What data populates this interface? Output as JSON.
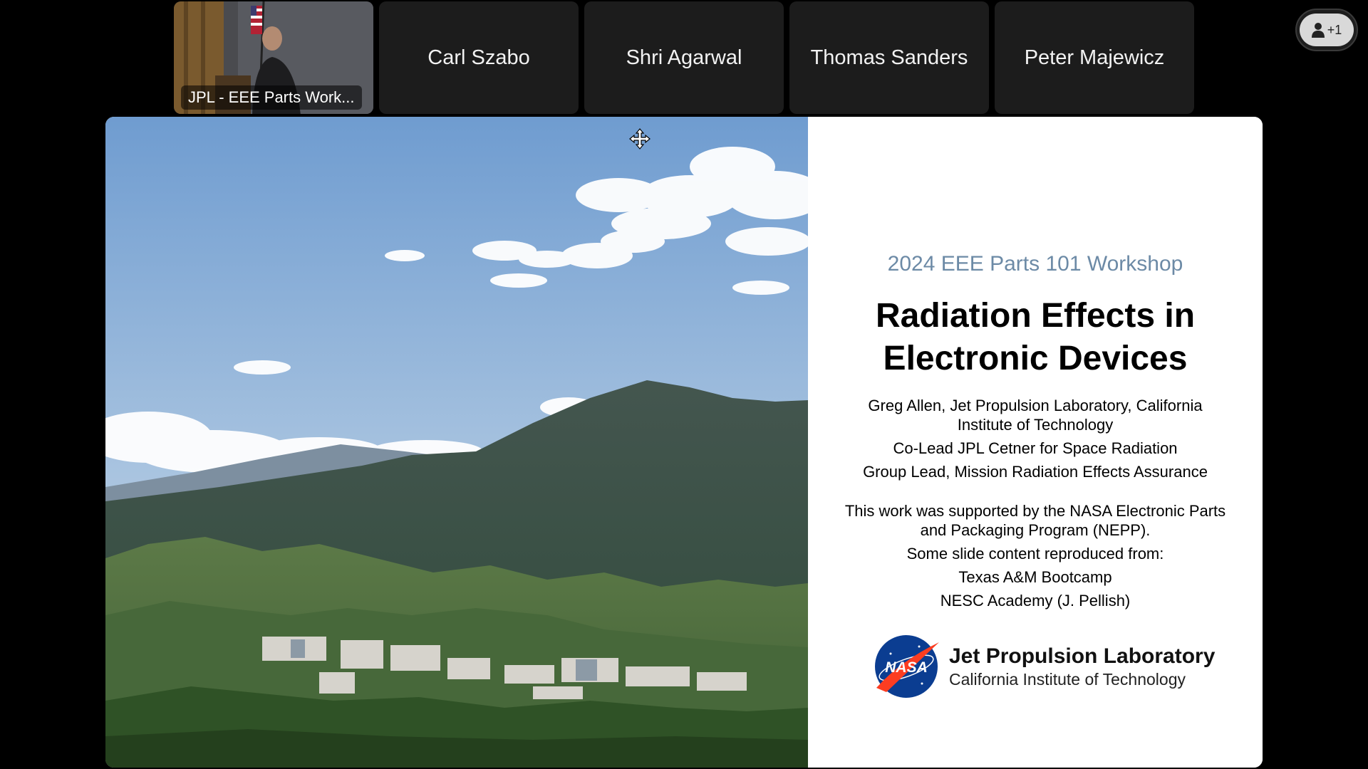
{
  "participants": {
    "video_tile_label": "JPL - EEE Parts Work...",
    "names": [
      "Carl Szabo",
      "Shri Agarwal",
      "Thomas Sanders",
      "Peter Majewicz"
    ],
    "overflow_badge": "+1"
  },
  "slide": {
    "workshop": "2024 EEE Parts 101 Workshop",
    "title_line1": "Radiation Effects in",
    "title_line2": "Electronic Devices",
    "author_line1": "Greg Allen, Jet Propulsion Laboratory, California",
    "author_line2": "Institute of Technology",
    "role1": "Co-Lead JPL Cetner for Space Radiation",
    "role2": "Group Lead, Mission Radiation Effects Assurance",
    "support_line1": "This work was supported by the NASA Electronic Parts",
    "support_line2": "and Packaging Program (NEPP).",
    "reproduced": "Some slide content reproduced from:",
    "source1": "Texas A&M Bootcamp",
    "source2": "NESC Academy (J. Pellish)",
    "logo_text": "NASA",
    "lab_name": "Jet Propulsion Laboratory",
    "lab_sub": "California Institute of Technology"
  },
  "colors": {
    "workshop_blue": "#6c8aa6",
    "nasa_blue": "#0b3d91",
    "nasa_red": "#fc3d21"
  }
}
